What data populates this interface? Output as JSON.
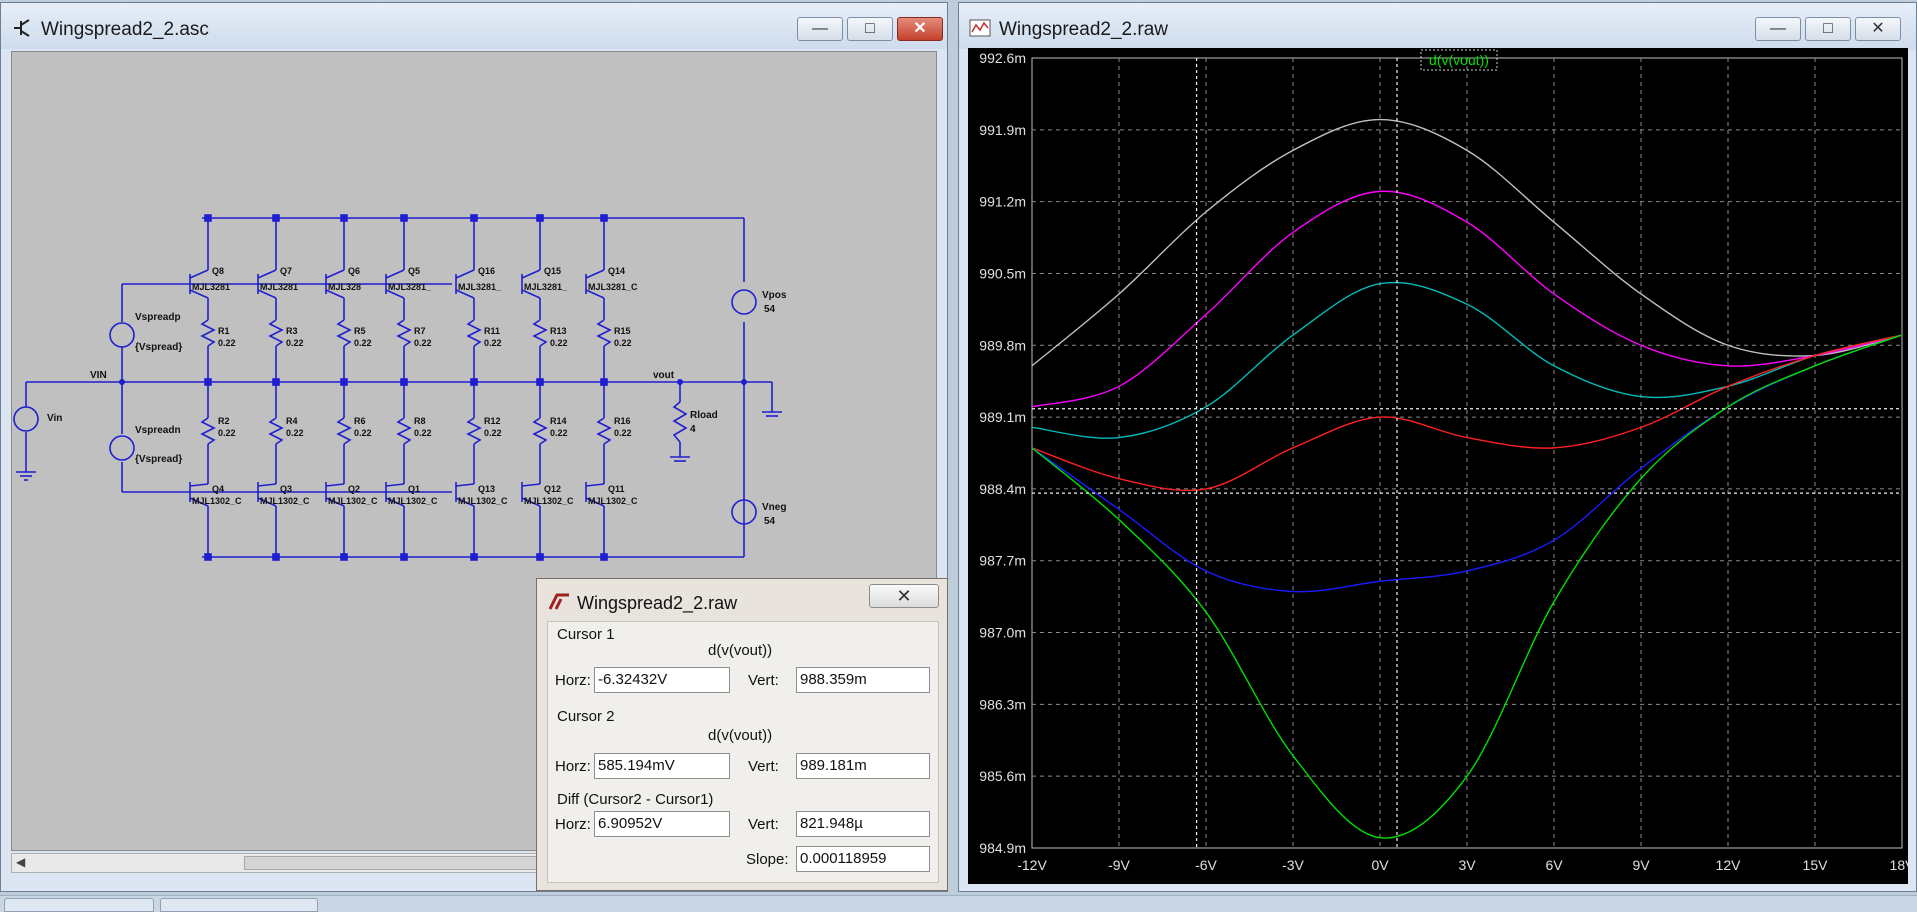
{
  "schematic_window": {
    "title": "Wingspread2_2.asc",
    "labels": {
      "q8": "Q8",
      "q7": "Q7",
      "q6": "Q6",
      "q5": "Q5",
      "q16": "Q16",
      "q15": "Q15",
      "q14": "Q14",
      "q4": "Q4",
      "q3": "Q3",
      "q2": "Q2",
      "q1": "Q1",
      "q13": "Q13",
      "q12": "Q12",
      "q11": "Q11",
      "npn_model": "MJL3281_C",
      "npn_short1": "MJL3281",
      "npn_short2": "MJL328",
      "npn_short3": "MJL3281_",
      "pnp_model": "MJL1302_C",
      "pnp_short1": "MJL1302_C",
      "r1": "R1",
      "r3": "R3",
      "r5": "R5",
      "r7": "R7",
      "r11": "R11",
      "r13": "R13",
      "r15": "R15",
      "r2": "R2",
      "r4": "R4",
      "r6": "R6",
      "r8": "R8",
      "r12": "R12",
      "r14": "R14",
      "r16": "R16",
      "rval": "0.22",
      "vspreadp": "Vspreadp",
      "vspreadn": "Vspreadn",
      "vspread": "{Vspread}",
      "vin": "Vin",
      "vin_net": "VIN",
      "vout": "vout",
      "rload": "Rload",
      "rload_val": "4",
      "vpos": "Vpos",
      "vneg": "Vneg",
      "supply_val": "54"
    }
  },
  "plot_window": {
    "title": "Wingspread2_2.raw",
    "trace_label": "d(v(vout))",
    "y_ticks": [
      "992.6m",
      "991.9m",
      "991.2m",
      "990.5m",
      "989.8m",
      "989.1m",
      "988.4m",
      "987.7m",
      "987.0m",
      "986.3m",
      "985.6m",
      "984.9m"
    ],
    "x_ticks": [
      "-12V",
      "-9V",
      "-6V",
      "-3V",
      "0V",
      "3V",
      "6V",
      "9V",
      "12V",
      "15V",
      "18V"
    ]
  },
  "cursor_dialog": {
    "title": "Wingspread2_2.raw",
    "cursor1": {
      "heading": "Cursor 1",
      "trace": "d(v(vout))",
      "horz_label": "Horz:",
      "horz": "-6.32432V",
      "vert_label": "Vert:",
      "vert": "988.359m"
    },
    "cursor2": {
      "heading": "Cursor 2",
      "trace": "d(v(vout))",
      "horz_label": "Horz:",
      "horz": "585.194mV",
      "vert_label": "Vert:",
      "vert": "989.181m"
    },
    "diff": {
      "heading": "Diff (Cursor2 - Cursor1)",
      "horz_label": "Horz:",
      "horz": "6.90952V",
      "vert_label": "Vert:",
      "vert": "821.948µ",
      "slope_label": "Slope:",
      "slope": "0.000118959"
    }
  },
  "chart_data": {
    "type": "line",
    "title": "d(v(vout))",
    "xlabel": "",
    "ylabel": "",
    "xlim": [
      -12,
      18
    ],
    "ylim": [
      984.9,
      992.6
    ],
    "y_unit": "m",
    "grid": true,
    "x_ticks": [
      "-12V",
      "-9V",
      "-6V",
      "-3V",
      "0V",
      "3V",
      "6V",
      "9V",
      "12V",
      "15V",
      "18V"
    ],
    "y_ticks": [
      "992.6m",
      "991.9m",
      "991.2m",
      "990.5m",
      "989.8m",
      "989.1m",
      "988.4m",
      "987.7m",
      "987.0m",
      "986.3m",
      "985.6m",
      "984.9m"
    ],
    "cursors": [
      {
        "x": -6.32432,
        "y": 988.359
      },
      {
        "x": 0.585194,
        "y": 989.181
      }
    ],
    "series": [
      {
        "color": "#c0c0c0",
        "x": [
          -12,
          -9,
          -6,
          -3,
          0,
          3,
          6,
          9,
          12,
          15,
          18
        ],
        "values": [
          989.6,
          990.3,
          991.1,
          991.7,
          992.0,
          991.7,
          991.0,
          990.3,
          989.8,
          989.7,
          989.9
        ]
      },
      {
        "color": "#ff00ff",
        "x": [
          -12,
          -9,
          -6,
          -3,
          0,
          3,
          6,
          9,
          12,
          15,
          18
        ],
        "values": [
          989.2,
          989.4,
          990.1,
          990.9,
          991.3,
          991.0,
          990.3,
          989.8,
          989.6,
          989.7,
          989.9
        ]
      },
      {
        "color": "#00bcbc",
        "x": [
          -12,
          -9,
          -6,
          -3,
          0,
          3,
          6,
          9,
          12,
          15,
          18
        ],
        "values": [
          989.0,
          988.9,
          989.2,
          989.9,
          990.4,
          990.2,
          989.6,
          989.3,
          989.4,
          989.7,
          989.9
        ]
      },
      {
        "color": "#ff2020",
        "x": [
          -12,
          -9,
          -6,
          -3,
          0,
          3,
          6,
          9,
          12,
          15,
          18
        ],
        "values": [
          988.8,
          988.5,
          988.4,
          988.8,
          989.1,
          988.9,
          988.8,
          989.0,
          989.4,
          989.7,
          989.9
        ]
      },
      {
        "color": "#1a1aff",
        "x": [
          -12,
          -9,
          -6,
          -3,
          0,
          3,
          6,
          9,
          12,
          15,
          18
        ],
        "values": [
          988.8,
          988.2,
          987.6,
          987.4,
          987.5,
          987.6,
          987.9,
          988.6,
          989.2,
          989.6,
          989.9
        ]
      },
      {
        "color": "#00e000",
        "x": [
          -12,
          -9,
          -6,
          -3,
          0,
          3,
          6,
          9,
          12,
          15,
          18
        ],
        "values": [
          988.8,
          988.1,
          987.2,
          985.8,
          985.0,
          985.6,
          987.3,
          988.5,
          989.2,
          989.6,
          989.9
        ]
      }
    ]
  }
}
